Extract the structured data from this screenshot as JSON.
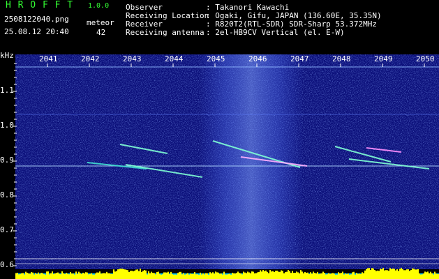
{
  "app": {
    "name": "H R O F F T",
    "version": "1.0.0"
  },
  "file": {
    "name": "2508122040.png",
    "timestamp": "25.08.12 20:40"
  },
  "meteor": {
    "label": "meteor",
    "count": "42"
  },
  "info": [
    {
      "key": "Observer",
      "value": ": Takanori Kawachi"
    },
    {
      "key": "Receiving Location",
      "value": ": Ogaki, Gifu, JAPAN (136.60E, 35.35N)"
    },
    {
      "key": "Receiver",
      "value": ": R820T2(RTL-SDR) SDR-Sharp 53.372MHz"
    },
    {
      "key": "Receiving antenna",
      "value": ": 2el-HB9CV Vertical (el. E-W)"
    }
  ],
  "plot": {
    "unit": "kHz",
    "time_ticks": [
      "2041",
      "2042",
      "2043",
      "2044",
      "2045",
      "2046",
      "2047",
      "2048",
      "2049",
      "2050"
    ],
    "freq_ticks": [
      "1.1",
      "1.0",
      "0.9",
      "0.8",
      "0.7",
      "0.6"
    ],
    "background_color": "#0b0f7a",
    "noise_color": "#3a5cff",
    "trace_color": "#7fffd4",
    "bar_color": "#ffff00",
    "bar_base_color": "#00d0ff"
  }
}
